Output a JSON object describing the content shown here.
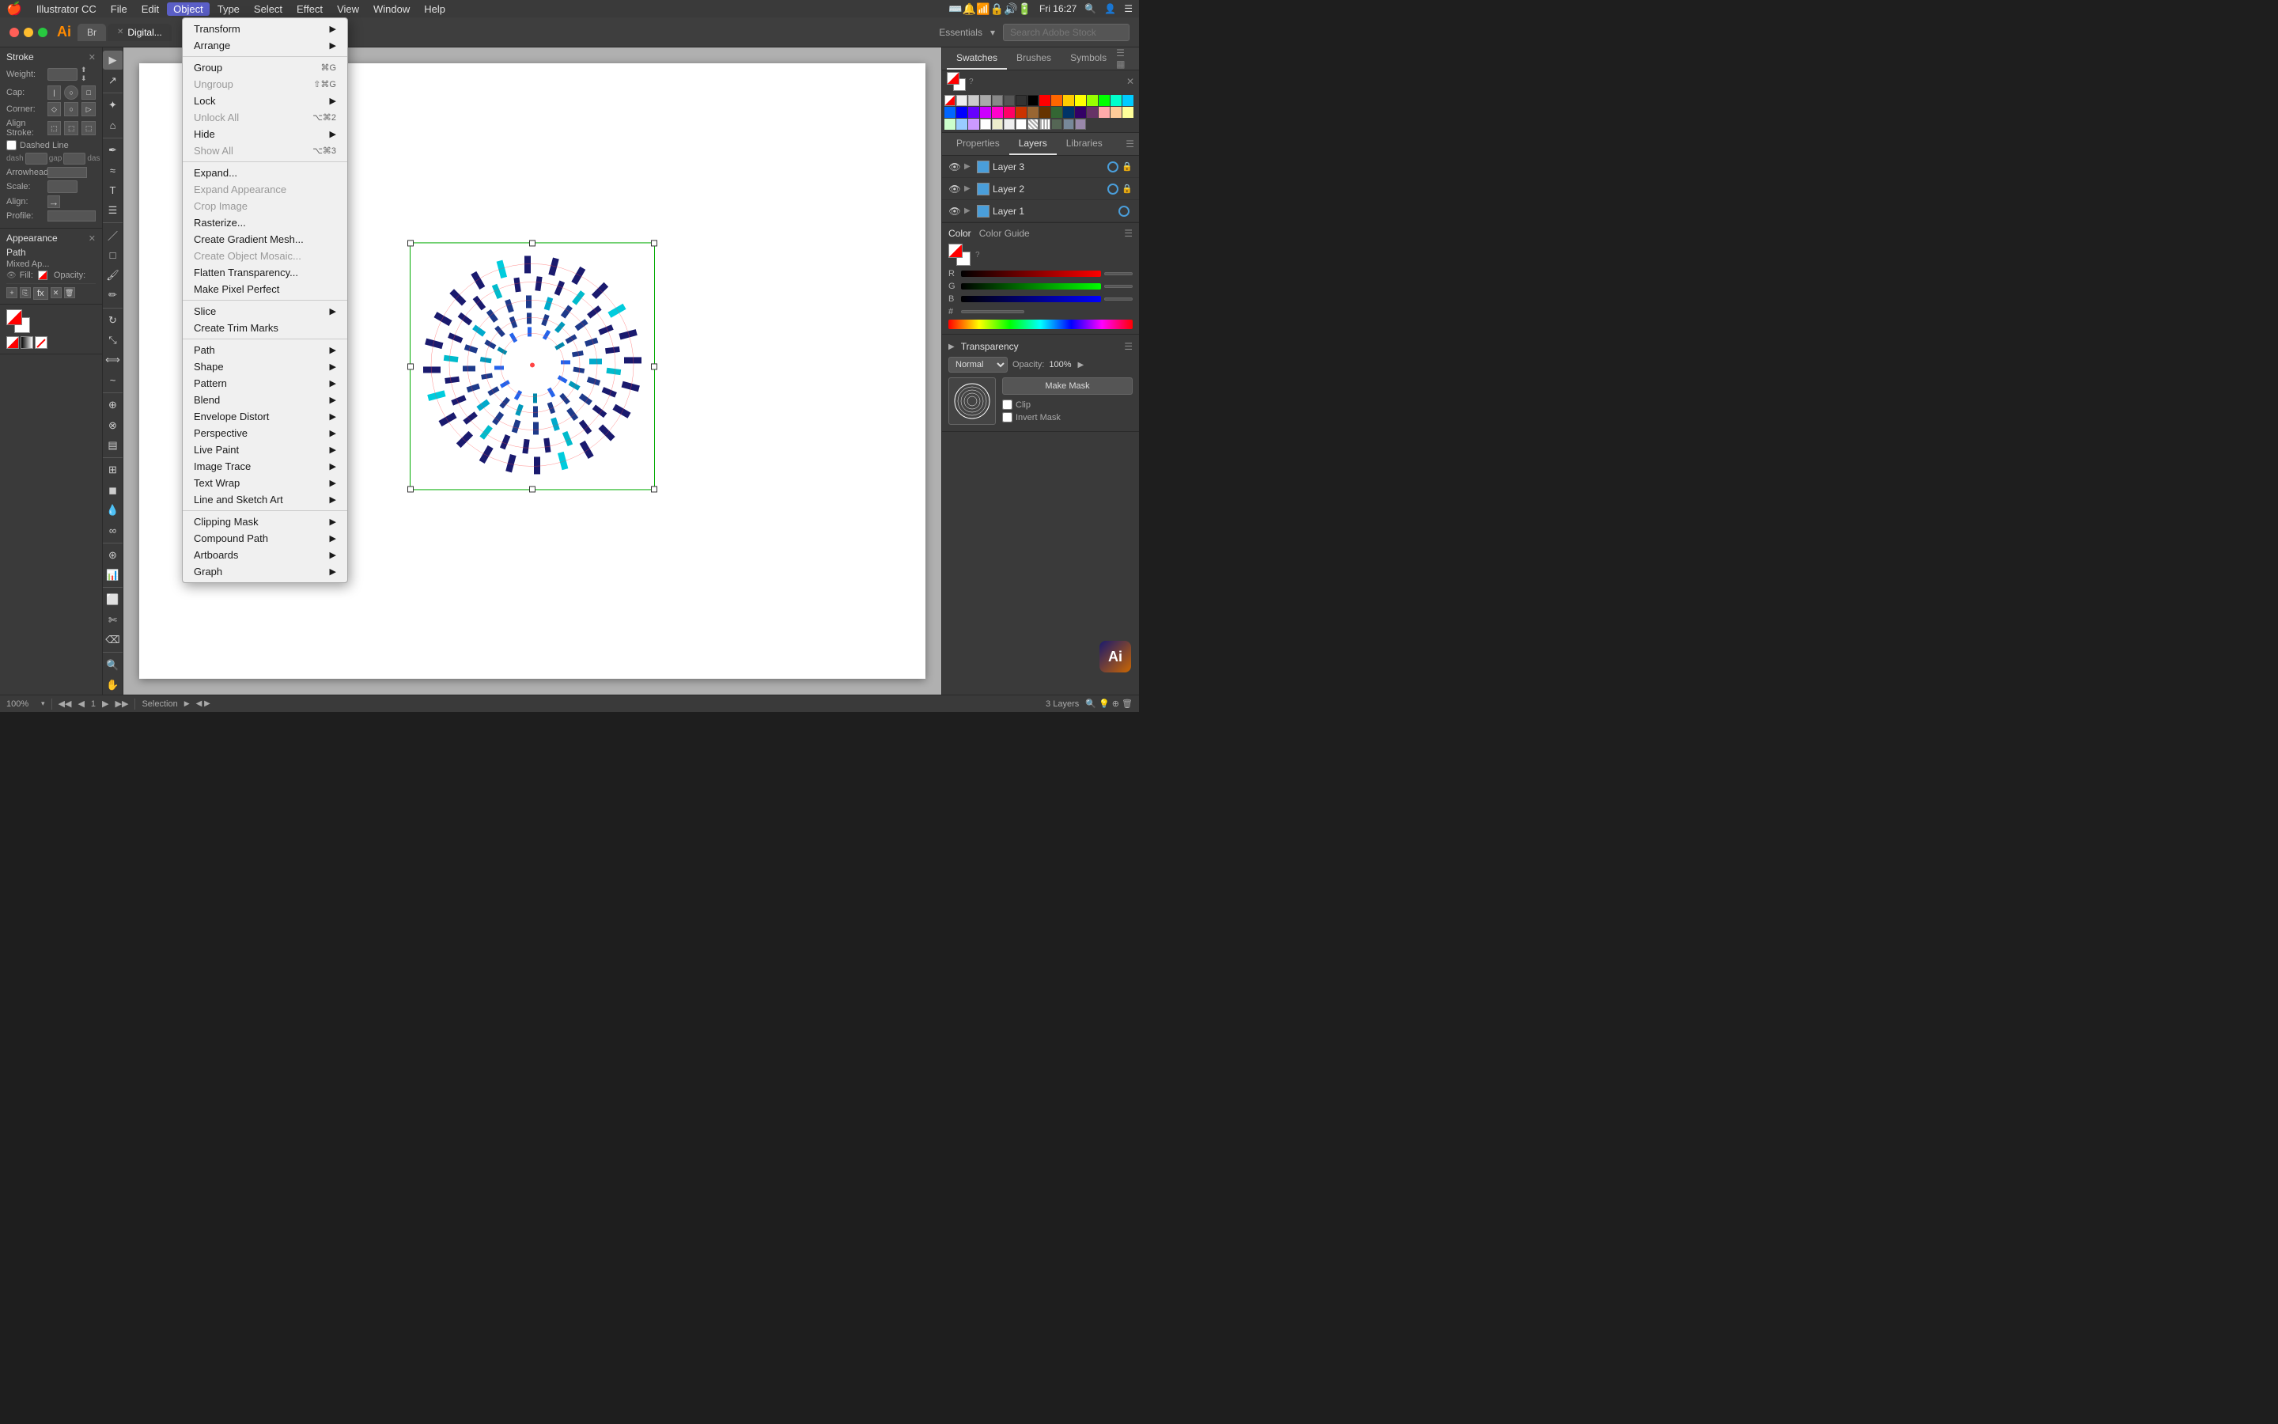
{
  "menubar": {
    "apple": "🍎",
    "app_name": "Illustrator CC",
    "items": [
      {
        "label": "File",
        "active": false
      },
      {
        "label": "Edit",
        "active": false
      },
      {
        "label": "Object",
        "active": true
      },
      {
        "label": "Type",
        "active": false
      },
      {
        "label": "Select",
        "active": false
      },
      {
        "label": "Effect",
        "active": false
      },
      {
        "label": "View",
        "active": false
      },
      {
        "label": "Window",
        "active": false
      },
      {
        "label": "Help",
        "active": false
      }
    ],
    "right_text": "Fri 16:27",
    "workspace": "Essentials"
  },
  "titlebar": {
    "app_logo": "Ai",
    "tabs": [
      {
        "label": "Br",
        "active": false,
        "closeable": false
      },
      {
        "label": "Digital...",
        "active": true,
        "closeable": true
      }
    ],
    "search_placeholder": "Search Adobe Stock"
  },
  "object_menu": {
    "title": "Object",
    "sections": [
      {
        "items": [
          {
            "label": "Transform",
            "shortcut": "",
            "has_sub": true,
            "disabled": false
          },
          {
            "label": "Arrange",
            "shortcut": "",
            "has_sub": true,
            "disabled": false
          }
        ]
      },
      {
        "items": [
          {
            "label": "Group",
            "shortcut": "⌘G",
            "has_sub": false,
            "disabled": false
          },
          {
            "label": "Ungroup",
            "shortcut": "⇧⌘G",
            "has_sub": false,
            "disabled": false
          },
          {
            "label": "Lock",
            "shortcut": "",
            "has_sub": true,
            "disabled": false
          },
          {
            "label": "Unlock All",
            "shortcut": "⌥⌘2",
            "has_sub": false,
            "disabled": false
          },
          {
            "label": "Hide",
            "shortcut": "",
            "has_sub": true,
            "disabled": false
          },
          {
            "label": "Show All",
            "shortcut": "⌥⌘3",
            "has_sub": false,
            "disabled": false
          }
        ]
      },
      {
        "items": [
          {
            "label": "Expand...",
            "shortcut": "",
            "has_sub": false,
            "disabled": false
          },
          {
            "label": "Expand Appearance",
            "shortcut": "",
            "has_sub": false,
            "disabled": false
          },
          {
            "label": "Crop Image",
            "shortcut": "",
            "has_sub": false,
            "disabled": false
          },
          {
            "label": "Rasterize...",
            "shortcut": "",
            "has_sub": false,
            "disabled": false
          },
          {
            "label": "Create Gradient Mesh...",
            "shortcut": "",
            "has_sub": false,
            "disabled": false
          },
          {
            "label": "Create Object Mosaic...",
            "shortcut": "",
            "has_sub": false,
            "disabled": true
          },
          {
            "label": "Flatten Transparency...",
            "shortcut": "",
            "has_sub": false,
            "disabled": false
          },
          {
            "label": "Make Pixel Perfect",
            "shortcut": "",
            "has_sub": false,
            "disabled": false
          }
        ]
      },
      {
        "items": [
          {
            "label": "Slice",
            "shortcut": "",
            "has_sub": true,
            "disabled": false
          },
          {
            "label": "Create Trim Marks",
            "shortcut": "",
            "has_sub": false,
            "disabled": false
          }
        ]
      },
      {
        "items": [
          {
            "label": "Path",
            "shortcut": "",
            "has_sub": true,
            "disabled": false
          },
          {
            "label": "Shape",
            "shortcut": "",
            "has_sub": true,
            "disabled": false
          },
          {
            "label": "Pattern",
            "shortcut": "",
            "has_sub": true,
            "disabled": false
          },
          {
            "label": "Blend",
            "shortcut": "",
            "has_sub": true,
            "disabled": false
          },
          {
            "label": "Envelope Distort",
            "shortcut": "",
            "has_sub": true,
            "disabled": false
          },
          {
            "label": "Perspective",
            "shortcut": "",
            "has_sub": true,
            "disabled": false
          },
          {
            "label": "Live Paint",
            "shortcut": "",
            "has_sub": true,
            "disabled": false
          },
          {
            "label": "Image Trace",
            "shortcut": "",
            "has_sub": true,
            "disabled": false
          },
          {
            "label": "Text Wrap",
            "shortcut": "",
            "has_sub": true,
            "disabled": false
          },
          {
            "label": "Line and Sketch Art",
            "shortcut": "",
            "has_sub": true,
            "disabled": false
          }
        ]
      },
      {
        "items": [
          {
            "label": "Clipping Mask",
            "shortcut": "",
            "has_sub": true,
            "disabled": false
          },
          {
            "label": "Compound Path",
            "shortcut": "",
            "has_sub": true,
            "disabled": false
          },
          {
            "label": "Artboards",
            "shortcut": "",
            "has_sub": true,
            "disabled": false
          },
          {
            "label": "Graph",
            "shortcut": "",
            "has_sub": true,
            "disabled": false
          }
        ]
      }
    ]
  },
  "stroke_panel": {
    "title": "Stroke",
    "weight_label": "Weight:",
    "weight_value": "",
    "cap_label": "Cap:",
    "corner_label": "Corner:",
    "align_label": "Align Stroke:",
    "dashed_label": "Dashed Line",
    "dash_label": "dash",
    "gap_label": "gap",
    "arrowheads_label": "Arrowheads:",
    "scale_label": "Scale:",
    "align_row_label": "Align:",
    "profile_label": "Profile:"
  },
  "appearance_panel": {
    "title": "Appearance",
    "path_label": "Path",
    "mixed_label": "Mixed Ap...",
    "fill_label": "Fill:",
    "opacity_label": "Opacity:"
  },
  "layers_panel": {
    "tabs": [
      "Properties",
      "Layers",
      "Libraries"
    ],
    "active_tab": "Layers",
    "layers": [
      {
        "name": "Layer 3",
        "visible": true,
        "locked": false,
        "color": "#4a9eda"
      },
      {
        "name": "Layer 2",
        "visible": true,
        "locked": false,
        "color": "#4a9eda"
      },
      {
        "name": "Layer 1",
        "visible": true,
        "locked": false,
        "color": "#4a9eda"
      }
    ],
    "layer_count": "3 Layers"
  },
  "swatches_panel": {
    "tabs": [
      "Swatches",
      "Brushes",
      "Symbols"
    ],
    "active_tab": "Swatches",
    "colors": [
      "#ffffff",
      "#cccccc",
      "#999999",
      "#666666",
      "#333333",
      "#000000",
      "#ff0000",
      "#ff6600",
      "#ffcc00",
      "#ffff00",
      "#99ff00",
      "#00ff00",
      "#00ffcc",
      "#00ccff",
      "#0066ff",
      "#0000ff",
      "#6600ff",
      "#cc00ff",
      "#ff00cc",
      "#ff0066",
      "#ff9999",
      "#ffcc99",
      "#ffffcc",
      "#ccffcc",
      "#99ccff",
      "#cc99ff",
      "#996633",
      "#663300",
      "#003366",
      "#006633",
      "#660066",
      "#cc3300",
      "#ff6699",
      "#99ff99",
      "#6699ff",
      "#ff99cc",
      "#cccc00",
      "#cc6600",
      "#009933",
      "#006699",
      "#9900cc",
      "#cc0066",
      "#ffcccc",
      "#ffe5cc",
      "#ffffee",
      "#eeffee",
      "#e5f0ff",
      "#f5e5ff"
    ]
  },
  "color_panel": {
    "title": "Color",
    "guide_title": "Color Guide",
    "r_label": "R",
    "g_label": "G",
    "b_label": "B",
    "hex_label": "#",
    "r_value": "",
    "g_value": "",
    "b_value": "",
    "hex_value": ""
  },
  "transparency_panel": {
    "title": "Transparency",
    "blend_mode": "Normal",
    "opacity_label": "Opacity:",
    "opacity_value": "100%",
    "make_mask_btn": "Make Mask",
    "clip_label": "Clip",
    "invert_mask_label": "Invert Mask"
  },
  "statusbar": {
    "zoom": "100%",
    "page": "1",
    "tool": "Selection",
    "layers": "3 Layers"
  },
  "canvas": {
    "artwork_desc": "circular blue pattern"
  }
}
